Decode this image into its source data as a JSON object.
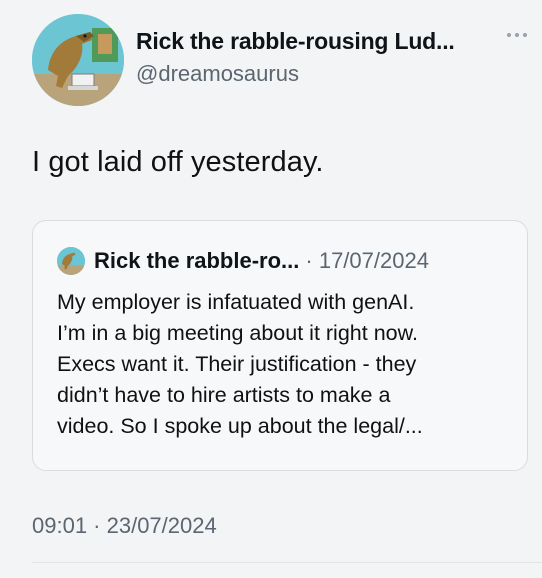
{
  "author": {
    "display_name": "Rick the rabble-rousing Lud...",
    "handle": "@dreamosaurus",
    "avatar_icon": "dinosaur-avatar-icon"
  },
  "tweet": {
    "text": "I got laid off yesterday.",
    "timestamp": "09:01 · 23/07/2024"
  },
  "quote": {
    "name": "Rick the rabble-ro...",
    "date": "· 17/07/2024",
    "body": "My employer is infatuated with genAI.\nI’m in a big meeting about it right now.\nExecs want it. Their justification - they\ndidn’t have to hire artists to make a\nvideo. So I spoke up about the legal/..."
  },
  "colors": {
    "background": "#f3f4f6",
    "text": "#0f1419",
    "muted": "#5b6670",
    "border": "#d8dde1"
  }
}
